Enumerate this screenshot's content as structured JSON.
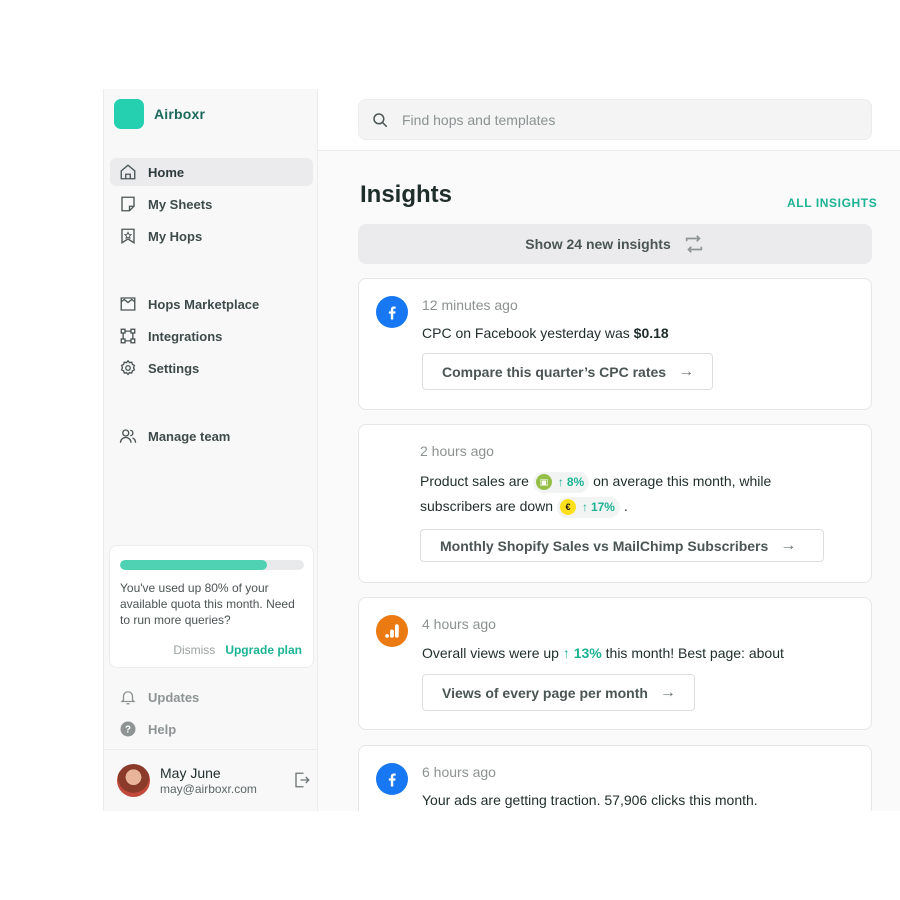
{
  "brand": {
    "name": "Airboxr",
    "color": "#25d0b0"
  },
  "sidebar": {
    "nav": [
      {
        "label": "Home",
        "icon": "home-icon",
        "active": true
      },
      {
        "label": "My Sheets",
        "icon": "sheet-icon"
      },
      {
        "label": "My Hops",
        "icon": "bookmark-star-icon"
      }
    ],
    "nav2": [
      {
        "label": "Hops Marketplace",
        "icon": "store-icon"
      },
      {
        "label": "Integrations",
        "icon": "integrations-icon"
      },
      {
        "label": "Settings",
        "icon": "gear-icon"
      }
    ],
    "nav3": [
      {
        "label": "Manage team",
        "icon": "users-icon"
      }
    ],
    "quota": {
      "percent_used": 80,
      "text": "You've used up 80% of your available quota this month. Need to run more queries?",
      "dismiss": "Dismiss",
      "upgrade": "Upgrade plan"
    },
    "footer_links": [
      {
        "label": "Updates",
        "icon": "bell-icon"
      },
      {
        "label": "Help",
        "icon": "help-icon"
      }
    ],
    "user": {
      "name": "May June",
      "email": "may@airboxr.com"
    }
  },
  "search": {
    "placeholder": "Find hops and templates"
  },
  "main": {
    "title": "Insights",
    "all_insights": "ALL INSIGHTS",
    "new_insights": "Show 24 new insights"
  },
  "cards": [
    {
      "time": "12 minutes ago",
      "msg_pre": "CPC on Facebook yesterday was ",
      "msg_bold": "$0.18",
      "button": "Compare this quarter’s CPC rates"
    },
    {
      "time": "2 hours ago",
      "msg_a": "Product sales are",
      "pill_a": "8%",
      "msg_b": "on average this month, while",
      "msg_c": "subscribers are down",
      "pill_b": "17%",
      "msg_d": ".",
      "button": "Monthly Shopify Sales vs MailChimp Subscribers"
    },
    {
      "time": "4 hours ago",
      "msg_a": "Overall views were up",
      "pct": "13%",
      "msg_b": "this month! Best page: about",
      "button": "Views of every page per month"
    },
    {
      "time": "6 hours ago",
      "msg": "Your ads are getting traction. 57,906 clicks this month."
    }
  ],
  "colors": {
    "accent": "#1bb393",
    "facebook": "#1877f2",
    "analytics": "#ea7a11"
  }
}
